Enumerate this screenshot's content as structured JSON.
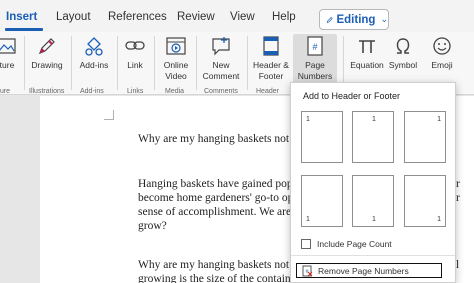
{
  "tabs": [
    {
      "label": "Insert",
      "active": true
    },
    {
      "label": "Layout"
    },
    {
      "label": "References"
    },
    {
      "label": "Review"
    },
    {
      "label": "View"
    },
    {
      "label": "Help"
    }
  ],
  "editing": {
    "label": "Editing"
  },
  "ribbon": {
    "buttons": {
      "picture": "ture",
      "drawing": "Drawing",
      "addins": "Add-ins",
      "link": "Link",
      "online_video_1": "Online",
      "online_video_2": "Video",
      "new_comment_1": "New",
      "new_comment_2": "Comment",
      "header_footer_1": "Header &",
      "header_footer_2": "Footer",
      "page_numbers_1": "Page",
      "page_numbers_2": "Numbers",
      "equation": "Equation",
      "symbol": "Symbol",
      "emoji": "Emoji"
    },
    "groups": {
      "pictures": "ture",
      "illustrations": "Illustrations",
      "addins": "Add-ins",
      "links": "Links",
      "media": "Media",
      "comments": "Comments",
      "header": "Header"
    }
  },
  "document": {
    "lines": [
      "Why are my hanging baskets not g",
      "Hanging baskets have gained popu",
      "become home gardeners' go-to opt",
      "sense of accomplishment. We are",
      "grow?",
      "Why are my hanging baskets not g",
      "growing is the size of the containe"
    ],
    "right_fragments": [
      "r",
      "r",
      "l"
    ]
  },
  "dropdown": {
    "title": "Add to Header or Footer",
    "thumbnails": [
      "1",
      "1",
      "1",
      "1",
      "1",
      "1"
    ],
    "include_page_count": "Include Page Count",
    "remove_page_numbers": "Remove Page Numbers"
  },
  "colors": {
    "accent": "#1b5fb5"
  }
}
